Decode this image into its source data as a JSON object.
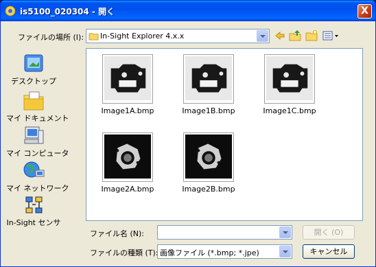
{
  "window": {
    "title": "is5100_020304 - 開く",
    "close_label": "X"
  },
  "toolbar": {
    "lookin_label": "ファイルの場所 (I):",
    "lookin_value": "In-Sight Explorer 4.x.x",
    "icons": [
      "back-icon",
      "up-folder-icon",
      "new-folder-icon",
      "view-menu-icon"
    ]
  },
  "places": [
    {
      "label": "デスクトップ",
      "icon": "desktop-icon"
    },
    {
      "label": "マイ ドキュメント",
      "icon": "my-documents-icon"
    },
    {
      "label": "マイ コンピュータ",
      "icon": "my-computer-icon"
    },
    {
      "label": "マイ ネットワーク",
      "icon": "my-network-icon"
    },
    {
      "label": "In-Sight センサ",
      "icon": "in-sight-sensor-icon"
    }
  ],
  "files": [
    {
      "name": "Image1A.bmp",
      "kind": "light"
    },
    {
      "name": "Image1B.bmp",
      "kind": "light"
    },
    {
      "name": "Image1C.bmp",
      "kind": "light"
    },
    {
      "name": "Image2A.bmp",
      "kind": "dark"
    },
    {
      "name": "Image2B.bmp",
      "kind": "dark"
    }
  ],
  "form": {
    "filename_label": "ファイル名 (N):",
    "filename_value": "",
    "filetype_label": "ファイルの種類 (T):",
    "filetype_value": "画像ファイル (*.bmp; *.jpe)",
    "open_label": "開く (O)",
    "cancel_label": "キャンセル"
  }
}
